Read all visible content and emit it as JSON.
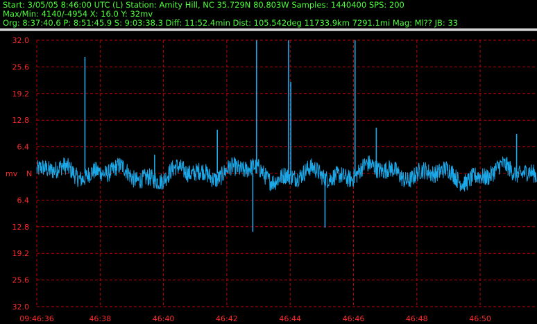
{
  "header": {
    "line1": "Start: 3/05/05  8:46:00 UTC (L) Station: Amity Hill, NC 35.729N 80.803W Samples: 1440400  SPS: 200",
    "line2": "Max/Min: 4140/-4954 X: 16.0 Y: 32mv",
    "line3": "Org: 8:37:40.6 P: 8:51:45.9 S: 9:03:38.3 Diff: 11:52.4min Dist: 105.542deg 11733.9km 7291.1mi  Mag: Ml?? JB: 33"
  },
  "colors": {
    "header_text": "#4cff3a",
    "grid": "#c00000",
    "trace": "#1aa8e8",
    "labels": "#ff2a2a",
    "background": "#000000"
  },
  "chart_data": {
    "type": "line",
    "ylabel": "mv",
    "zero_label": "N",
    "y_ticks_top": [
      "32.0",
      "25.6",
      "19.2",
      "12.8",
      "6.4"
    ],
    "y_ticks_bottom": [
      "6.4",
      "12.8",
      "19.2",
      "25.6",
      "32.0"
    ],
    "ylim": [
      -32,
      32
    ],
    "x_ticks": [
      "09:46:36",
      "46:38",
      "46:40",
      "46:42",
      "46:44",
      "46:46",
      "46:48",
      "46:50"
    ],
    "x_range_seconds": [
      0,
      16
    ],
    "grid": true,
    "series": [
      {
        "noise_amplitude_mv": 2.2,
        "spikes": [
          {
            "t": 1.52,
            "value": 28.0
          },
          {
            "t": 3.72,
            "value": 4.5
          },
          {
            "t": 5.7,
            "value": 10.5
          },
          {
            "t": 6.82,
            "value": -14.0
          },
          {
            "t": 6.94,
            "value": 32.0
          },
          {
            "t": 7.95,
            "value": 32.0
          },
          {
            "t": 8.02,
            "value": 22.0
          },
          {
            "t": 9.1,
            "value": -13.0
          },
          {
            "t": 10.05,
            "value": 32.0
          },
          {
            "t": 10.72,
            "value": 11.0
          },
          {
            "t": 15.15,
            "value": 9.5
          }
        ]
      }
    ]
  }
}
